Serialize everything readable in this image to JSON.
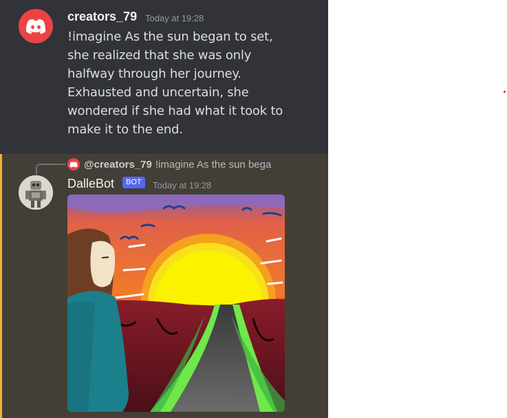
{
  "message_1": {
    "author": "creators_79",
    "timestamp": "Today at 19:28",
    "lines": [
      "!imagine As the sun began to set,",
      "she realized that she was only",
      "halfway through her journey.",
      "Exhausted and uncertain, she",
      "wondered if she had what it took to",
      "make it to the end."
    ],
    "avatar_icon": "discord-logo-icon",
    "avatar_color": "#ed4245"
  },
  "message_2": {
    "reply": {
      "author": "@creators_79",
      "text": "!imagine As the sun bega",
      "icon": "discord-logo-icon"
    },
    "author": "DalleBot",
    "badge": "BOT",
    "timestamp": "Today at 19:28",
    "avatar_icon": "robot-icon",
    "image_icon": "generated-image"
  },
  "colors": {
    "background": "#313338",
    "mention_highlight": "#433f37",
    "mention_bar": "#f0b232",
    "bot_badge": "#5865f2",
    "text": "#dbdee1",
    "muted": "#949ba4"
  }
}
